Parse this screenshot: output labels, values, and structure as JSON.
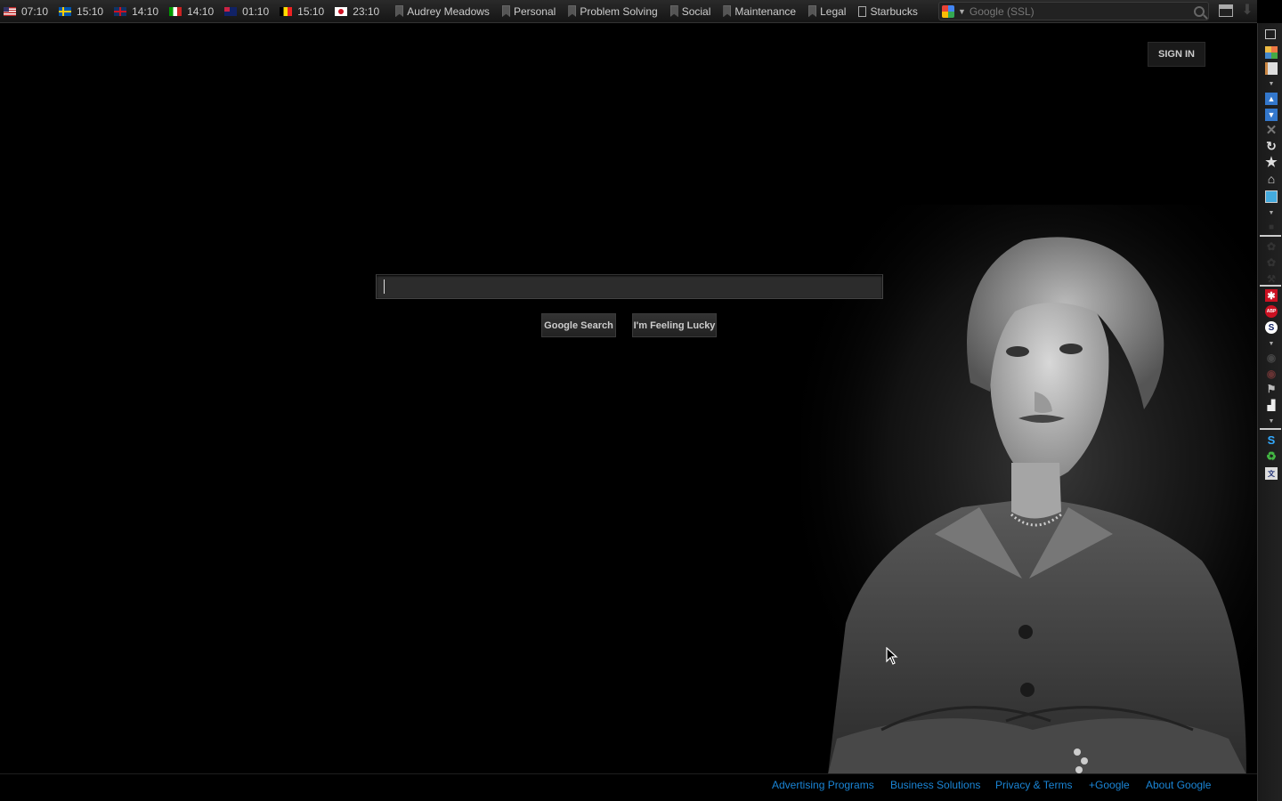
{
  "clocks": [
    {
      "flag": "us",
      "time": "07:10"
    },
    {
      "flag": "se",
      "time": "15:10"
    },
    {
      "flag": "gb",
      "time": "14:10"
    },
    {
      "flag": "it",
      "time": "14:10"
    },
    {
      "flag": "au",
      "time": "01:10"
    },
    {
      "flag": "be",
      "time": "15:10"
    },
    {
      "flag": "jp",
      "time": "23:10"
    }
  ],
  "bookmarks": [
    "Audrey Meadows",
    "Personal",
    "Problem Solving",
    "Social",
    "Maintenance",
    "Legal",
    "Starbucks"
  ],
  "search_engine": {
    "placeholder": "Google (SSL)"
  },
  "page": {
    "signin_label": "SIGN IN",
    "search_value": "",
    "search_button": "Google Search",
    "lucky_button": "I'm Feeling Lucky"
  },
  "footer": {
    "links": [
      "Advertising Programs",
      "Business Solutions",
      "Privacy & Terms",
      "+Google",
      "About Google"
    ]
  },
  "colors": {
    "link": "#1a85d6",
    "background": "#000000"
  },
  "sidebar_icons": [
    "tabs-icon",
    "apps-icon",
    "notes-icon",
    "dropdown-icon",
    "bookmark-up-icon",
    "bookmark-down-icon",
    "close-icon",
    "reload-icon",
    "star-icon",
    "home-icon",
    "tab-icon",
    "dropdown-icon",
    "camera-icon",
    "gear-icon",
    "gear-icon",
    "wrench-icon",
    "cross-icon",
    "adblock-icon",
    "skype-icon",
    "dropdown-icon",
    "globe-icon",
    "globe-icon",
    "flag-icon",
    "puzzle-icon",
    "dropdown-icon",
    "s-icon",
    "recycle-icon",
    "translate-icon"
  ]
}
